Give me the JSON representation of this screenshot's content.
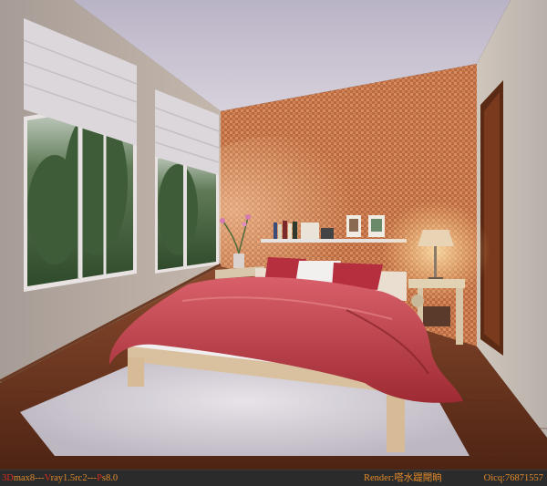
{
  "caption": {
    "software": [
      {
        "key": "3D",
        "rest": "max8---",
        "key_color": "#d62a1e",
        "rest_color": "#e08a2c"
      },
      {
        "key": "V",
        "rest": "ray1.5rc2---",
        "key_color": "#d62a1e",
        "rest_color": "#e08a2c"
      },
      {
        "key": "P",
        "rest": "s8.0",
        "key_color": "#d62a1e",
        "rest_color": "#e08a2c"
      }
    ],
    "render_credit": "Render:嗒水踶閜晌",
    "render_color": "#e38a2a",
    "qq": "Oicq:76871557",
    "qq_color": "#e38a2a"
  }
}
